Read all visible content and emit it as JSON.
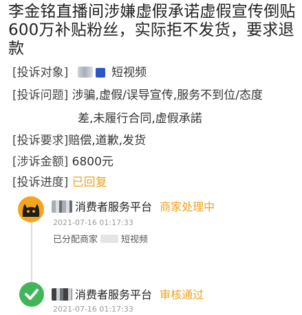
{
  "title": "李金铭直播间涉嫌虚假承诺虚假宣传倒贴600万补贴粉丝，实际拒不发货，要求退款",
  "fields": {
    "object": {
      "label": "[投诉对象]",
      "value": "短视频"
    },
    "problem": {
      "label": "[投诉问题]",
      "value": "涉骗,虚假/误导宣传,服务不到位/态度",
      "cont": "差,未履行合同,虚假承諾"
    },
    "request": {
      "label": "[投诉要求]",
      "value": "赔偿,道歉,发货"
    },
    "amount": {
      "label": "[涉诉金额]",
      "value": "6800元"
    },
    "progress": {
      "label": "[投诉进度]",
      "value": "已回复"
    }
  },
  "timeline": [
    {
      "platform": "消费者服务平台",
      "status": "商家处理中",
      "time": "2021-07-16 01:17:33",
      "note_prefix": "已分配商家",
      "note_suffix": "短视频",
      "icon": "cat-avatar-icon"
    },
    {
      "platform": "消费者服务平台",
      "status": "审核通过",
      "time": "2021-07-16 01:17:33",
      "icon": "check-circle-icon"
    }
  ],
  "colors": {
    "status": "#f0a21a",
    "check": "#40b55a",
    "avatar": "#f3a51e"
  }
}
